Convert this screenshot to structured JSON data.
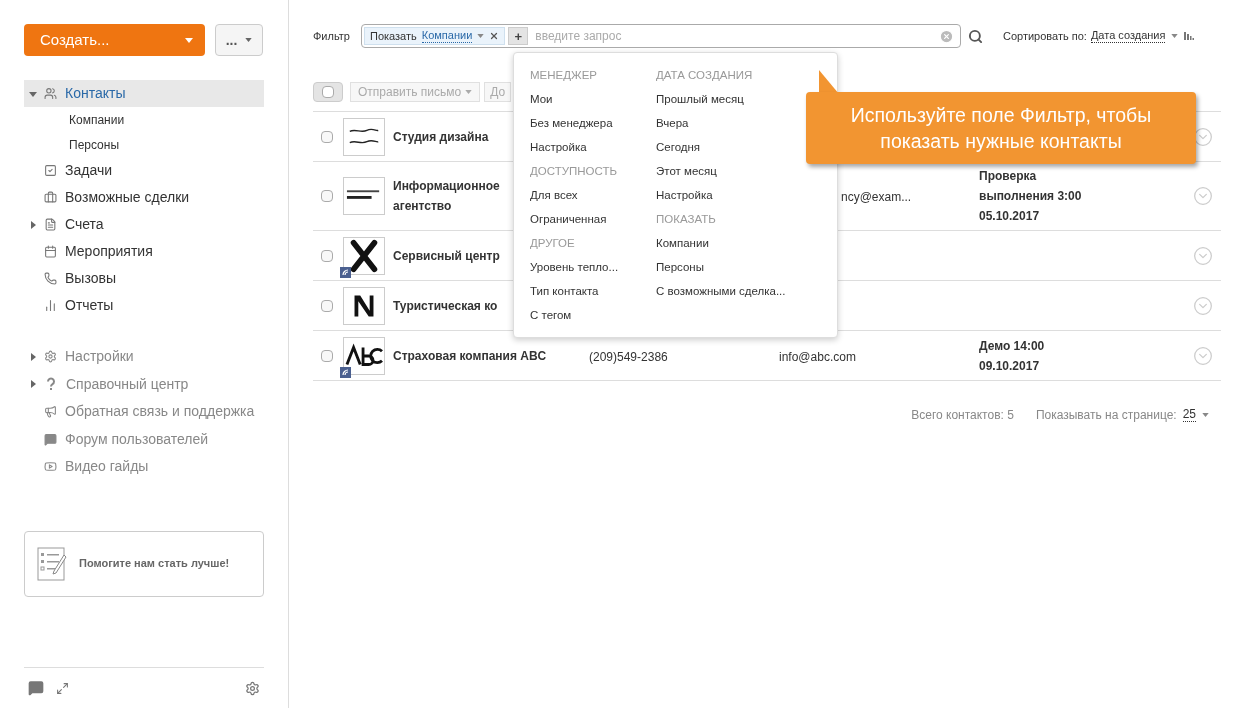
{
  "sidebar": {
    "create_button": "Создать...",
    "more_button": "...",
    "items": [
      {
        "label": "Контакты",
        "selected": true,
        "expanded": true,
        "has_children": true,
        "children": [
          {
            "label": "Компании",
            "selected": false
          },
          {
            "label": "Персоны",
            "selected": false
          }
        ]
      },
      {
        "label": "Задачи",
        "selected": false,
        "has_children": false
      },
      {
        "label": "Возможные сделки",
        "selected": false,
        "has_children": false
      },
      {
        "label": "Счета",
        "selected": false,
        "expanded": false,
        "has_children": true
      },
      {
        "label": "Мероприятия",
        "selected": false,
        "has_children": false
      },
      {
        "label": "Вызовы",
        "selected": false,
        "has_children": false
      },
      {
        "label": "Отчеты",
        "selected": false,
        "has_children": false
      }
    ],
    "secondary_items": [
      {
        "label": "Настройки",
        "has_children": true
      },
      {
        "label": "Справочный центр",
        "has_children": true
      },
      {
        "label": "Обратная связь и поддержка",
        "has_children": false
      },
      {
        "label": "Форум пользователей",
        "has_children": false
      },
      {
        "label": "Видео гайды",
        "has_children": false
      }
    ],
    "feedback_card": "Помогите нам стать лучше!"
  },
  "filter": {
    "label": "Фильтр",
    "tag_label": "Показать",
    "tag_value": "Компании",
    "add": "+",
    "placeholder": "введите запрос"
  },
  "sort": {
    "label": "Сортировать по:",
    "value": "Дата создания"
  },
  "toolbar": {
    "select_all_checked": false,
    "send_mail": "Отправить письмо",
    "next_button": "До"
  },
  "rows": [
    {
      "checked": false,
      "name": "Студия дизайна",
      "phone": "",
      "email": "",
      "task": [],
      "badge": false
    },
    {
      "checked": false,
      "name": "Информационное агентство",
      "phone": "",
      "email": "ncy@exam...",
      "email_partial": true,
      "task": [
        "Проверка",
        "выполнения 3:00",
        "05.10.2017"
      ],
      "badge": false
    },
    {
      "checked": false,
      "name": "Сервисный центр",
      "phone": "",
      "email": "",
      "task": [],
      "badge": true
    },
    {
      "checked": false,
      "name": "Туристическая ко",
      "phone": "",
      "email": "",
      "task": [],
      "badge": false
    },
    {
      "checked": false,
      "name": "Страховая компания ABC",
      "phone": "(209)549-2386",
      "email": "info@abc.com",
      "email_partial": false,
      "task": [
        "Демо 14:00",
        "09.10.2017"
      ],
      "badge": true
    }
  ],
  "footer": {
    "total": "Всего контактов: 5",
    "per_page_label": "Показывать на странице:",
    "per_page": "25"
  },
  "dropdown": {
    "columns": [
      [
        {
          "heading": "МЕНЕДЖЕР",
          "items": [
            "Мои",
            "Без менеджера",
            "Настройка"
          ]
        },
        {
          "heading": "ДОСТУПНОСТЬ",
          "items": [
            "Для всех",
            "Ограниченная"
          ]
        },
        {
          "heading": "ДРУГОЕ",
          "items": [
            "Уровень тепло...",
            "Тип контакта",
            "С тегом"
          ]
        }
      ],
      [
        {
          "heading": "ДАТА СОЗДАНИЯ",
          "items": [
            "Прошлый месяц",
            "Вчера",
            "Сегодня",
            "Этот месяц",
            "Настройка"
          ]
        },
        {
          "heading": "ПОКАЗАТЬ",
          "items": [
            "Компании",
            "Персоны",
            "С возможными сделка..."
          ]
        }
      ]
    ]
  },
  "tooltip": "Используйте поле Фильтр, чтобы показать нужные контакты"
}
